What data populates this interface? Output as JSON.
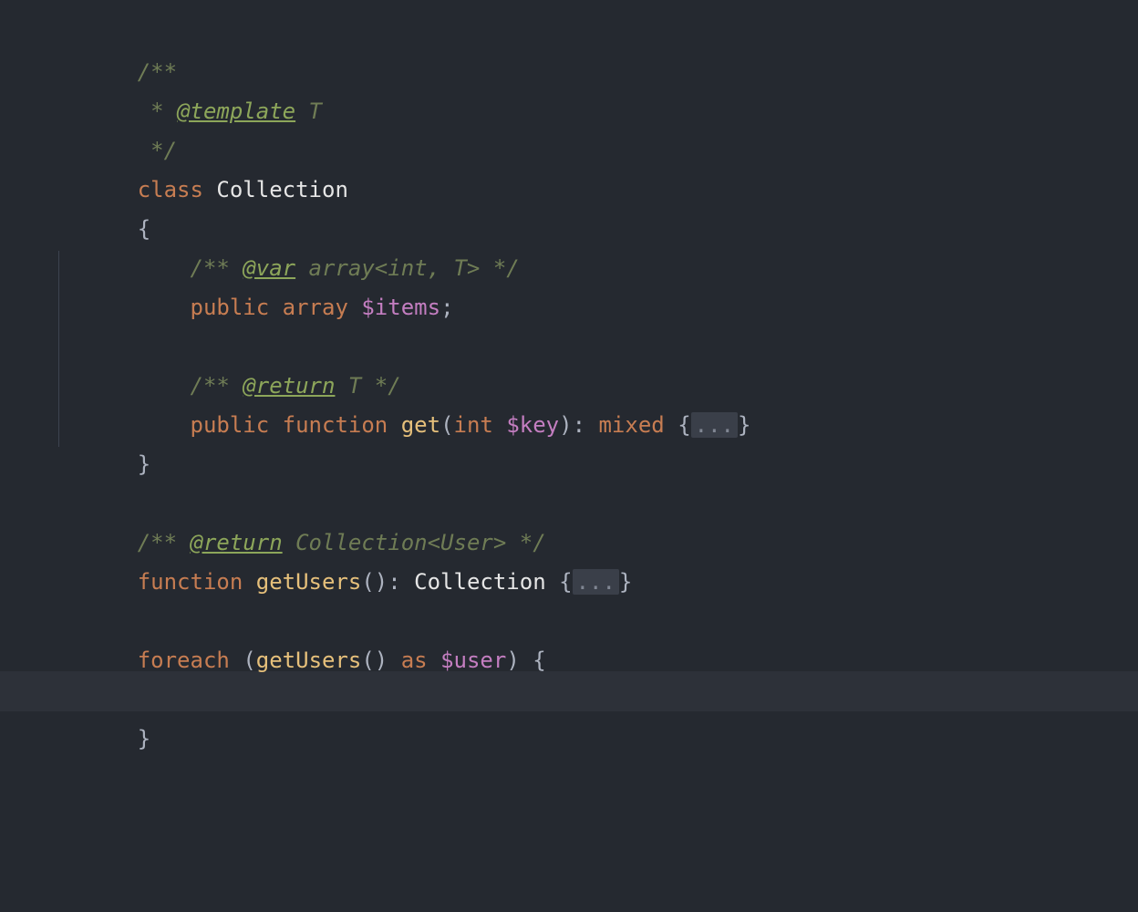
{
  "code": {
    "line1": "/**",
    "line2_a": " * ",
    "line2_tag": "@template",
    "line2_b": " T",
    "line3": " */",
    "line4_kw": "class",
    "line4_sp": " ",
    "line4_name": "Collection",
    "line5": "{",
    "line6_a": "    ",
    "line6_b": "/** ",
    "line6_tag": "@var",
    "line6_c": " array<int, T> */",
    "line7_a": "    ",
    "line7_pub": "public",
    "line7_sp1": " ",
    "line7_arr": "array",
    "line7_sp2": " ",
    "line7_var": "$items",
    "line7_semi": ";",
    "line9_a": "    ",
    "line9_b": "/** ",
    "line9_tag": "@return",
    "line9_c": " T */",
    "line10_a": "    ",
    "line10_pub": "public",
    "line10_sp1": " ",
    "line10_fn": "function",
    "line10_sp2": " ",
    "line10_name": "get",
    "line10_op": "(",
    "line10_int": "int",
    "line10_sp3": " ",
    "line10_var": "$key",
    "line10_cp": ")",
    "line10_col": ": ",
    "line10_mixed": "mixed",
    "line10_sp4": " ",
    "line10_ob": "{",
    "line10_fold": "...",
    "line10_cb": "}",
    "line11": "}",
    "line13_a": "/** ",
    "line13_tag": "@return",
    "line13_b": " Collection<User> */",
    "line14_fn": "function",
    "line14_sp1": " ",
    "line14_name": "getUsers",
    "line14_op": "()",
    "line14_col": ": ",
    "line14_type": "Collection",
    "line14_sp2": " ",
    "line14_ob": "{",
    "line14_fold": "...",
    "line14_cb": "}",
    "line16_kw": "foreach",
    "line16_sp1": " ",
    "line16_op": "(",
    "line16_fn": "getUsers",
    "line16_call": "()",
    "line16_sp2": " ",
    "line16_as": "as",
    "line16_sp3": " ",
    "line16_var": "$user",
    "line16_cp": ")",
    "line16_sp4": " ",
    "line16_ob": "{",
    "line18": "}"
  }
}
